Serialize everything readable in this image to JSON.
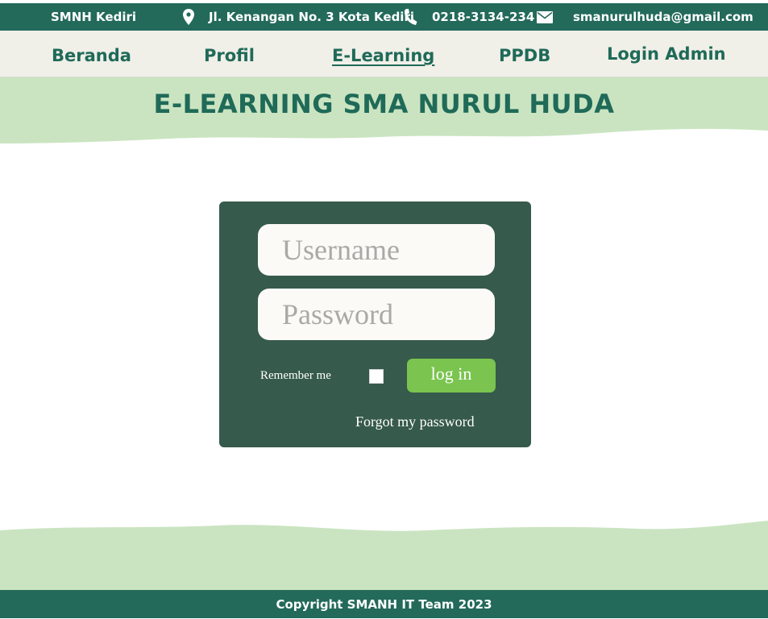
{
  "topbar": {
    "school": "SMNH Kediri",
    "address_icon": "map-pin-icon",
    "address": "Jl. Kenangan No. 3 Kota Kediri",
    "phone_icon": "phone-icon",
    "phone": "0218-3134-234",
    "email_icon": "mail-icon",
    "email": "smanurulhuda@gmail.com"
  },
  "nav": {
    "items": [
      {
        "label": "Beranda"
      },
      {
        "label": "Profil"
      },
      {
        "label": "E-Learning",
        "active": true
      },
      {
        "label": "PPDB"
      },
      {
        "label": "Login Admin"
      }
    ]
  },
  "hero": {
    "title": "E-LEARNING SMA NURUL HUDA"
  },
  "login": {
    "username_placeholder": "Username",
    "password_placeholder": "Password",
    "remember_label": "Remember me",
    "remember_checked": false,
    "login_label": "log in",
    "forgot_label": "Forgot my password"
  },
  "footer": {
    "copyright": "Copyright SMANH IT Team 2023"
  },
  "colors": {
    "primary": "#236a5b",
    "nav_text": "#1f6a58",
    "light_green": "#cae4c1",
    "card": "#365a4c",
    "button": "#7ac44f",
    "nav_bg": "#f0efe8"
  }
}
